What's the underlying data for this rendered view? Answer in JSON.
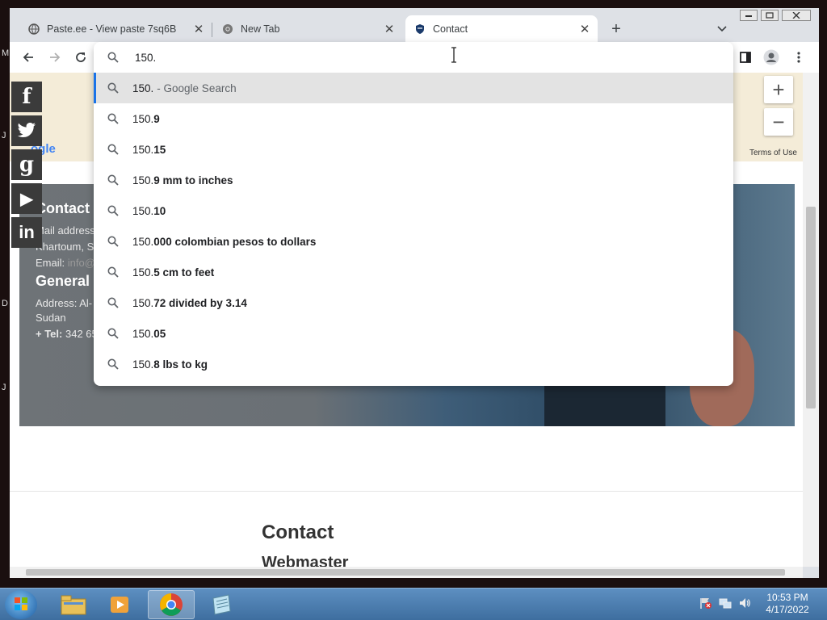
{
  "desktop": {
    "side_letters": [
      "M",
      "J",
      "D",
      "J"
    ]
  },
  "browser": {
    "tabs": [
      {
        "title": "Paste.ee - View paste 7sq6B",
        "favicon": "globe-icon"
      },
      {
        "title": "New Tab",
        "favicon": "chrome-icon"
      },
      {
        "title": "Contact",
        "favicon": "shield-icon"
      }
    ],
    "omnibox": {
      "value": "150.",
      "suggestions": [
        {
          "typed": "150.",
          "rest": "",
          "suffix": "- Google Search"
        },
        {
          "typed": "150.",
          "rest": "9",
          "suffix": ""
        },
        {
          "typed": "150.",
          "rest": "15",
          "suffix": ""
        },
        {
          "typed": "150.",
          "rest": "9 mm to inches",
          "suffix": ""
        },
        {
          "typed": "150.",
          "rest": "10",
          "suffix": ""
        },
        {
          "typed": "150.",
          "rest": "000 colombian pesos to dollars",
          "suffix": ""
        },
        {
          "typed": "150.",
          "rest": "5 cm to feet",
          "suffix": ""
        },
        {
          "typed": "150.",
          "rest": "72 divided by 3.14",
          "suffix": ""
        },
        {
          "typed": "150.",
          "rest": "05",
          "suffix": ""
        },
        {
          "typed": "150.",
          "rest": "8 lbs to kg",
          "suffix": ""
        }
      ]
    }
  },
  "page": {
    "map": {
      "logo_text": "ogle",
      "terms": "Terms of Use",
      "zoom_in": "+",
      "zoom_out": "−"
    },
    "hero": {
      "heading": "Contact u",
      "mail_line": "Mail address",
      "city_line": "Khartoum, S",
      "email_label": "Email:",
      "email_value": "info@",
      "general_heading": "General",
      "address_line": "Address: Al-",
      "sudan_line": "Sudan",
      "tel_label": "+ Tel:",
      "tel_value": "342 65"
    },
    "contact_heading": "Contact",
    "webmaster_heading": "Webmaster"
  },
  "social": [
    "f",
    "twitter",
    "g",
    "▶",
    "in"
  ],
  "taskbar": {
    "time": "10:53 PM",
    "date": "4/17/2022"
  },
  "colors": {
    "omni_highlight": "#1a73e8",
    "taskbar": "#3e6e9f"
  }
}
